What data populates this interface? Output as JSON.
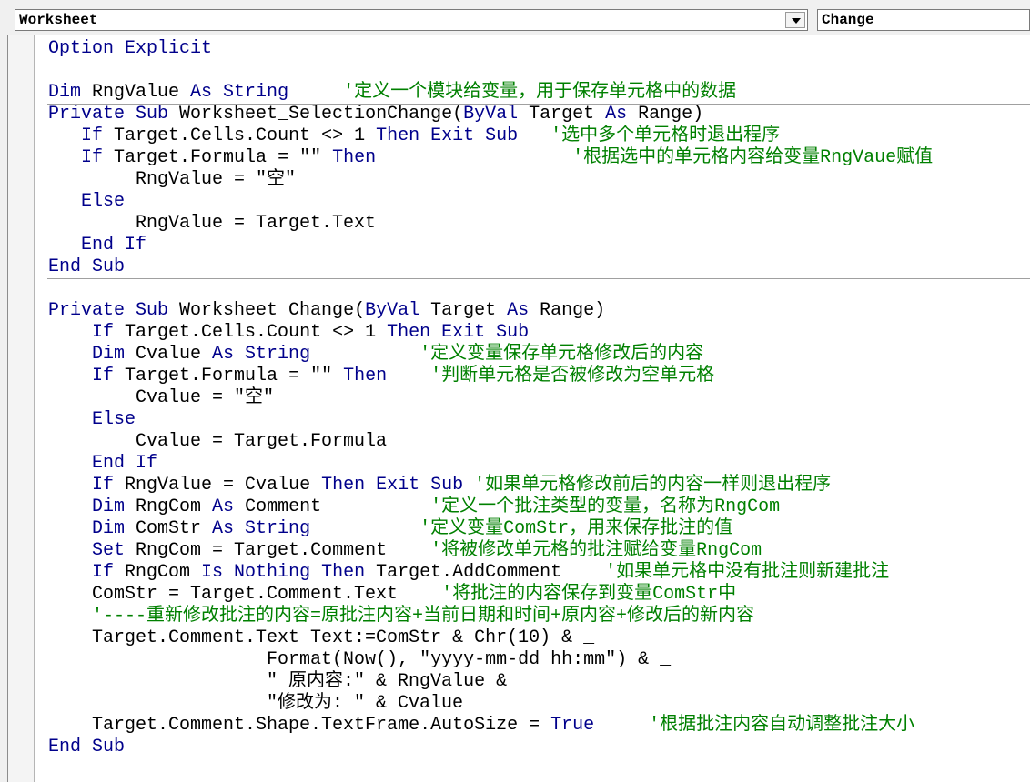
{
  "toolbar": {
    "object_value": "Worksheet",
    "procedure_value": "Change"
  },
  "code": {
    "lines": [
      [
        {
          "t": "kw",
          "v": "Option Explicit"
        }
      ],
      [],
      [
        {
          "t": "kw",
          "v": "Dim"
        },
        {
          "t": "tx",
          "v": " RngValue "
        },
        {
          "t": "kw",
          "v": "As String"
        },
        {
          "t": "tx",
          "v": "     "
        },
        {
          "t": "cm",
          "v": "'定义一个模块给变量，用于保存单元格中的数据"
        }
      ],
      [
        {
          "t": "kw",
          "v": "Private Sub"
        },
        {
          "t": "tx",
          "v": " Worksheet_SelectionChange("
        },
        {
          "t": "kw",
          "v": "ByVal"
        },
        {
          "t": "tx",
          "v": " Target "
        },
        {
          "t": "kw",
          "v": "As"
        },
        {
          "t": "tx",
          "v": " Range)"
        }
      ],
      [
        {
          "t": "tx",
          "v": "   "
        },
        {
          "t": "kw",
          "v": "If"
        },
        {
          "t": "tx",
          "v": " Target.Cells.Count <> 1 "
        },
        {
          "t": "kw",
          "v": "Then Exit Sub"
        },
        {
          "t": "tx",
          "v": "   "
        },
        {
          "t": "cm",
          "v": "'选中多个单元格时退出程序"
        }
      ],
      [
        {
          "t": "tx",
          "v": "   "
        },
        {
          "t": "kw",
          "v": "If"
        },
        {
          "t": "tx",
          "v": " Target.Formula = \"\" "
        },
        {
          "t": "kw",
          "v": "Then"
        },
        {
          "t": "tx",
          "v": "                  "
        },
        {
          "t": "cm",
          "v": "'根据选中的单元格内容给变量RngVaue赋值"
        }
      ],
      [
        {
          "t": "tx",
          "v": "        RngValue = \"空\""
        }
      ],
      [
        {
          "t": "tx",
          "v": "   "
        },
        {
          "t": "kw",
          "v": "Else"
        }
      ],
      [
        {
          "t": "tx",
          "v": "        RngValue = Target.Text"
        }
      ],
      [
        {
          "t": "tx",
          "v": "   "
        },
        {
          "t": "kw",
          "v": "End If"
        }
      ],
      [
        {
          "t": "kw",
          "v": "End Sub"
        }
      ],
      [],
      [
        {
          "t": "kw",
          "v": "Private Sub"
        },
        {
          "t": "tx",
          "v": " Worksheet_Change("
        },
        {
          "t": "kw",
          "v": "ByVal"
        },
        {
          "t": "tx",
          "v": " Target "
        },
        {
          "t": "kw",
          "v": "As"
        },
        {
          "t": "tx",
          "v": " Range)"
        }
      ],
      [
        {
          "t": "tx",
          "v": "    "
        },
        {
          "t": "kw",
          "v": "If"
        },
        {
          "t": "tx",
          "v": " Target.Cells.Count <> 1 "
        },
        {
          "t": "kw",
          "v": "Then Exit Sub"
        }
      ],
      [
        {
          "t": "tx",
          "v": "    "
        },
        {
          "t": "kw",
          "v": "Dim"
        },
        {
          "t": "tx",
          "v": " Cvalue "
        },
        {
          "t": "kw",
          "v": "As String"
        },
        {
          "t": "tx",
          "v": "          "
        },
        {
          "t": "cm",
          "v": "'定义变量保存单元格修改后的内容"
        }
      ],
      [
        {
          "t": "tx",
          "v": "    "
        },
        {
          "t": "kw",
          "v": "If"
        },
        {
          "t": "tx",
          "v": " Target.Formula = \"\" "
        },
        {
          "t": "kw",
          "v": "Then"
        },
        {
          "t": "tx",
          "v": "    "
        },
        {
          "t": "cm",
          "v": "'判断单元格是否被修改为空单元格"
        }
      ],
      [
        {
          "t": "tx",
          "v": "        Cvalue = \"空\""
        }
      ],
      [
        {
          "t": "tx",
          "v": "    "
        },
        {
          "t": "kw",
          "v": "Else"
        }
      ],
      [
        {
          "t": "tx",
          "v": "        Cvalue = Target.Formula"
        }
      ],
      [
        {
          "t": "tx",
          "v": "    "
        },
        {
          "t": "kw",
          "v": "End If"
        }
      ],
      [
        {
          "t": "tx",
          "v": "    "
        },
        {
          "t": "kw",
          "v": "If"
        },
        {
          "t": "tx",
          "v": " RngValue = Cvalue "
        },
        {
          "t": "kw",
          "v": "Then Exit Sub"
        },
        {
          "t": "tx",
          "v": " "
        },
        {
          "t": "cm",
          "v": "'如果单元格修改前后的内容一样则退出程序"
        }
      ],
      [
        {
          "t": "tx",
          "v": "    "
        },
        {
          "t": "kw",
          "v": "Dim"
        },
        {
          "t": "tx",
          "v": " RngCom "
        },
        {
          "t": "kw",
          "v": "As"
        },
        {
          "t": "tx",
          "v": " Comment          "
        },
        {
          "t": "cm",
          "v": "'定义一个批注类型的变量，名称为RngCom"
        }
      ],
      [
        {
          "t": "tx",
          "v": "    "
        },
        {
          "t": "kw",
          "v": "Dim"
        },
        {
          "t": "tx",
          "v": " ComStr "
        },
        {
          "t": "kw",
          "v": "As String"
        },
        {
          "t": "tx",
          "v": "          "
        },
        {
          "t": "cm",
          "v": "'定义变量ComStr，用来保存批注的值"
        }
      ],
      [
        {
          "t": "tx",
          "v": "    "
        },
        {
          "t": "kw",
          "v": "Set"
        },
        {
          "t": "tx",
          "v": " RngCom = Target.Comment    "
        },
        {
          "t": "cm",
          "v": "'将被修改单元格的批注赋给变量RngCom"
        }
      ],
      [
        {
          "t": "tx",
          "v": "    "
        },
        {
          "t": "kw",
          "v": "If"
        },
        {
          "t": "tx",
          "v": " RngCom "
        },
        {
          "t": "kw",
          "v": "Is Nothing Then"
        },
        {
          "t": "tx",
          "v": " Target.AddComment    "
        },
        {
          "t": "cm",
          "v": "'如果单元格中没有批注则新建批注"
        }
      ],
      [
        {
          "t": "tx",
          "v": "    ComStr = Target.Comment.Text    "
        },
        {
          "t": "cm",
          "v": "'将批注的内容保存到变量ComStr中"
        }
      ],
      [
        {
          "t": "tx",
          "v": "    "
        },
        {
          "t": "cm",
          "v": "'----重新修改批注的内容=原批注内容+当前日期和时间+原内容+修改后的新内容"
        }
      ],
      [
        {
          "t": "tx",
          "v": "    Target.Comment.Text Text:=ComStr & Chr(10) & _"
        }
      ],
      [
        {
          "t": "tx",
          "v": "                    Format(Now(), \"yyyy-mm-dd hh:mm\") & _"
        }
      ],
      [
        {
          "t": "tx",
          "v": "                    \" 原内容:\" & RngValue & _"
        }
      ],
      [
        {
          "t": "tx",
          "v": "                    \"修改为: \" & Cvalue"
        }
      ],
      [
        {
          "t": "tx",
          "v": "    Target.Comment.Shape.TextFrame.AutoSize = "
        },
        {
          "t": "kw",
          "v": "True"
        },
        {
          "t": "tx",
          "v": "     "
        },
        {
          "t": "cm",
          "v": "'根据批注内容自动调整批注大小"
        }
      ],
      [
        {
          "t": "kw",
          "v": "End Sub"
        }
      ]
    ]
  }
}
